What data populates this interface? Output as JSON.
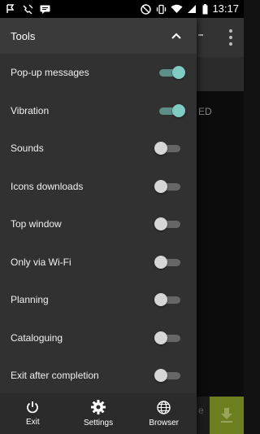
{
  "status": {
    "time": "13:17"
  },
  "background": {
    "tab_fragment": "ED",
    "fragment_e": "e"
  },
  "drawer": {
    "title": "Tools",
    "items": [
      {
        "label": "Pop-up messages",
        "on": true
      },
      {
        "label": "Vibration",
        "on": true
      },
      {
        "label": "Sounds",
        "on": false
      },
      {
        "label": "Icons downloads",
        "on": false
      },
      {
        "label": "Top window",
        "on": false
      },
      {
        "label": "Only via Wi-Fi",
        "on": false
      },
      {
        "label": "Planning",
        "on": false
      },
      {
        "label": "Cataloguing",
        "on": false
      },
      {
        "label": "Exit after completion",
        "on": false
      }
    ],
    "bottom_nav": [
      {
        "label": "Exit",
        "icon": "power-icon"
      },
      {
        "label": "Settings",
        "icon": "gear-icon"
      },
      {
        "label": "Browser",
        "icon": "globe-icon"
      }
    ]
  },
  "colors": {
    "accent": "#80cbc4",
    "fab": "#6b7f1e"
  }
}
